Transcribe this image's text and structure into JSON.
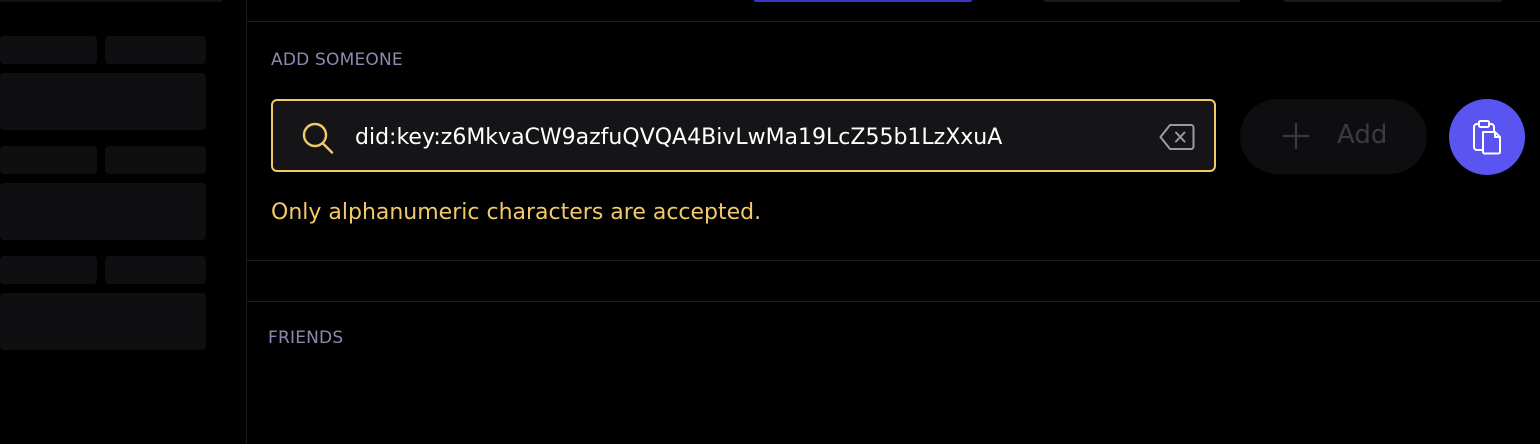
{
  "colors": {
    "background": "#000000",
    "accent": "#5a55f0",
    "warning": "#f2c96a",
    "section_label": "#8d8ab0",
    "input_bg": "#151518",
    "divider": "#1c1c20"
  },
  "add_someone": {
    "section_label": "ADD SOMEONE",
    "search": {
      "value": "did:key:z6MkvaCW9azfuQVQA4BivLwMa19LcZ55b1LzXxuA",
      "search_icon": "search-icon",
      "clear_icon": "backspace-clear-icon"
    },
    "add_button": {
      "label": "Add",
      "icon": "plus-icon",
      "state": "disabled"
    },
    "paste_button": {
      "icon": "clipboard-icon"
    },
    "error_message": "Only alphanumeric characters are accepted."
  },
  "friends": {
    "section_label": "FRIENDS"
  }
}
